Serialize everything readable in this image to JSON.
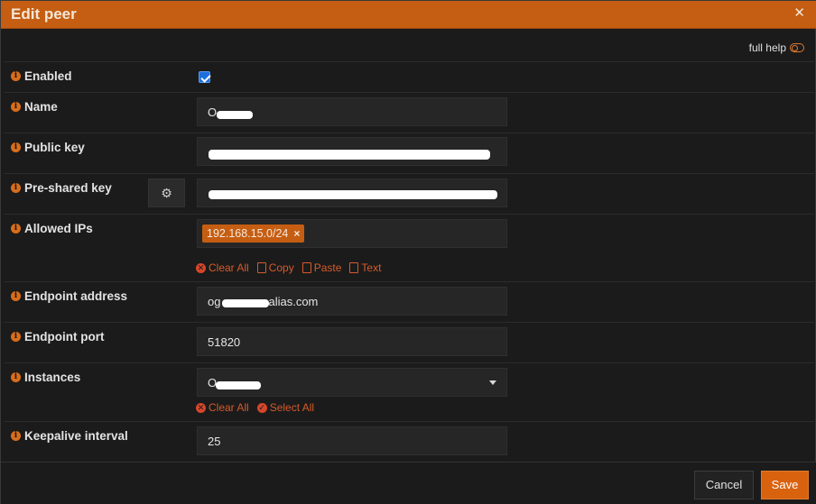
{
  "dialog": {
    "title": "Edit peer",
    "close_glyph": "✕",
    "full_help_label": "full help"
  },
  "fields": {
    "enabled": {
      "label": "Enabled",
      "checked": true
    },
    "name": {
      "label": "Name",
      "value": "O"
    },
    "public_key": {
      "label": "Public key",
      "value": ""
    },
    "pre_shared_key": {
      "label": "Pre-shared key",
      "value": "",
      "gear_icon": "⚙"
    },
    "allowed_ips": {
      "label": "Allowed IPs",
      "tag": "192.168.15.0/24",
      "tag_remove": "×"
    },
    "endpoint_address": {
      "label": "Endpoint address",
      "value_prefix": "og",
      "value_suffix": "alias.com"
    },
    "endpoint_port": {
      "label": "Endpoint port",
      "value": "51820"
    },
    "instances": {
      "label": "Instances",
      "value": "O"
    },
    "keepalive_interval": {
      "label": "Keepalive interval",
      "value": "25"
    }
  },
  "tag_actions": {
    "clear_all": "Clear All",
    "copy": "Copy",
    "paste": "Paste",
    "text": "Text"
  },
  "select_actions": {
    "clear_all": "Clear All",
    "select_all": "Select All"
  },
  "footer": {
    "cancel_label": "Cancel",
    "save_label": "Save"
  },
  "colors": {
    "accent": "#c55e12",
    "background": "#1b1b1b",
    "link": "#d65a2a",
    "checkbox": "#1d6fe0"
  },
  "icons": {
    "info": "info-circle-icon",
    "settings": "gear-icon",
    "close": "close-icon",
    "toggle": "toggle-off-icon"
  }
}
